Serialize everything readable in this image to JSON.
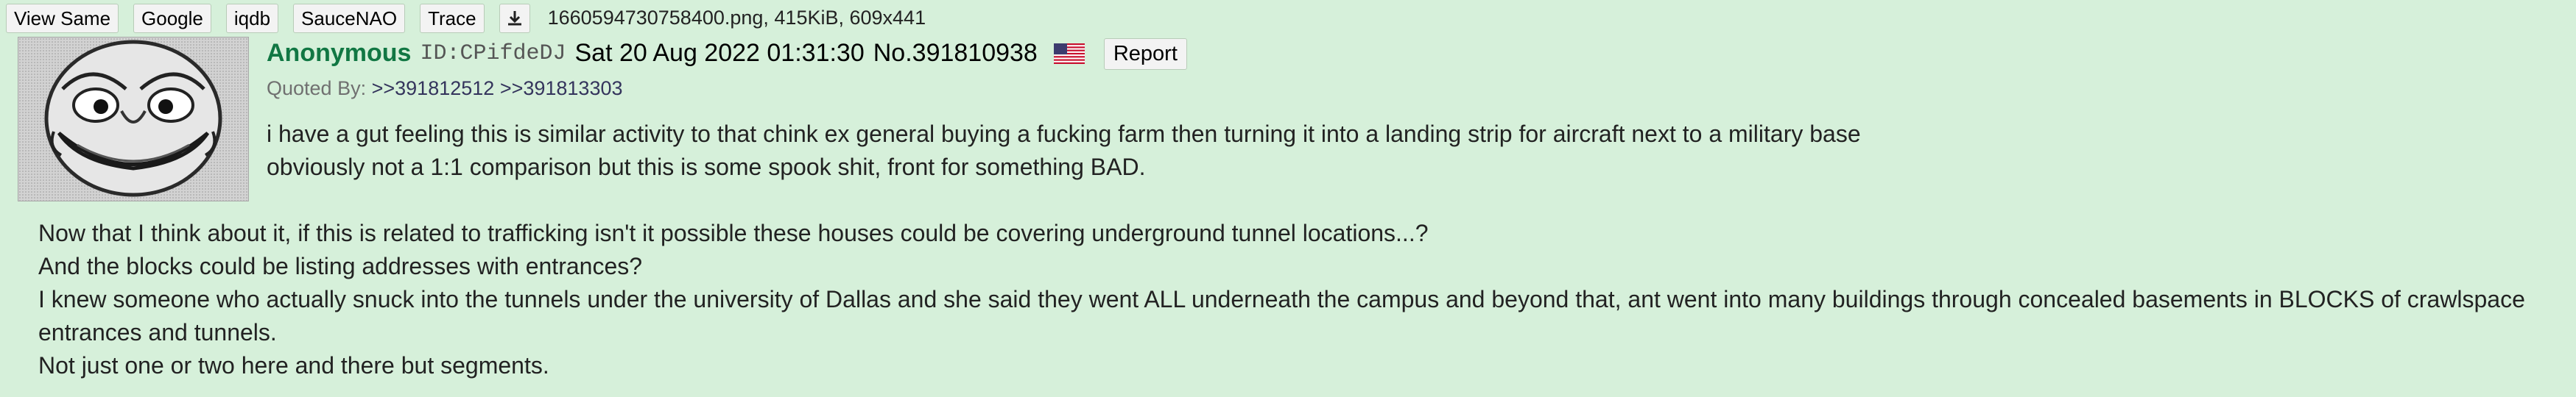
{
  "toolbar": {
    "buttons": [
      "View Same",
      "Google",
      "iqdb",
      "SauceNAO",
      "Trace"
    ],
    "download_icon": "download-icon",
    "file_info": "1660594730758400.png, 415KiB, 609x441"
  },
  "post": {
    "name": "Anonymous",
    "id_text": "ID:CPifdeDJ",
    "date": "Sat 20 Aug 2022 01:31:30",
    "number": "No.391810938",
    "flag": "us-flag-icon",
    "report_label": "Report",
    "quoted_by_label": "Quoted By:",
    "quoted_by": [
      ">>391812512",
      ">>391813303"
    ],
    "body_top": [
      "i have a gut feeling this is similar activity to that chink ex general buying a fucking farm then turning it into a landing strip for aircraft next to a military base",
      "obviously not a 1:1 comparison but this is some spook shit, front for something BAD."
    ],
    "body_bottom": [
      "Now that I think about it, if this is related to trafficking isn't it possible these houses could be covering underground tunnel locations...?",
      "And the blocks could be listing addresses with entrances?",
      "I knew someone who actually snuck into the tunnels under the university of Dallas and she said they went ALL underneath the campus and beyond that, ant went into many buildings through concealed basements in BLOCKS of crawlspace",
      "entrances and tunnels.",
      "Not just one or two here and there but segments."
    ]
  },
  "colors": {
    "background": "#d6f0da",
    "name": "#117743",
    "quote_link": "#34345c"
  }
}
